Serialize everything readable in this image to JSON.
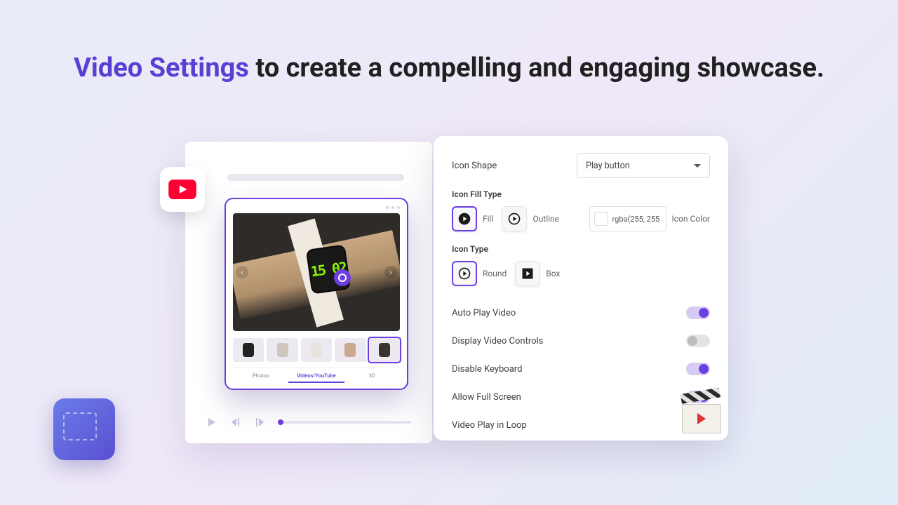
{
  "headline": {
    "highlight": "Video Settings",
    "rest": " to create a compelling and engaging showcase."
  },
  "preview": {
    "tabs": [
      "Photos",
      "Videos/YouTube",
      "3D"
    ],
    "active_tab_index": 1,
    "watch_time": "15 02"
  },
  "settings": {
    "icon_shape": {
      "label": "Icon Shape",
      "value": "Play button"
    },
    "icon_fill_type": {
      "label": "Icon Fill Type",
      "options": [
        "Fill",
        "Outline"
      ],
      "selected_index": 0,
      "color_value": "rgba(255, 255",
      "color_label": "Icon Color"
    },
    "icon_type": {
      "label": "Icon Type",
      "options": [
        "Round",
        "Box"
      ],
      "selected_index": 0
    },
    "toggles": [
      {
        "label": "Auto Play Video",
        "on": true
      },
      {
        "label": "Display Video Controls",
        "on": false
      },
      {
        "label": "Disable Keyboard",
        "on": true
      },
      {
        "label": "Allow Full Screen",
        "on": true
      },
      {
        "label": "Video Play in Loop",
        "on": true
      }
    ]
  }
}
